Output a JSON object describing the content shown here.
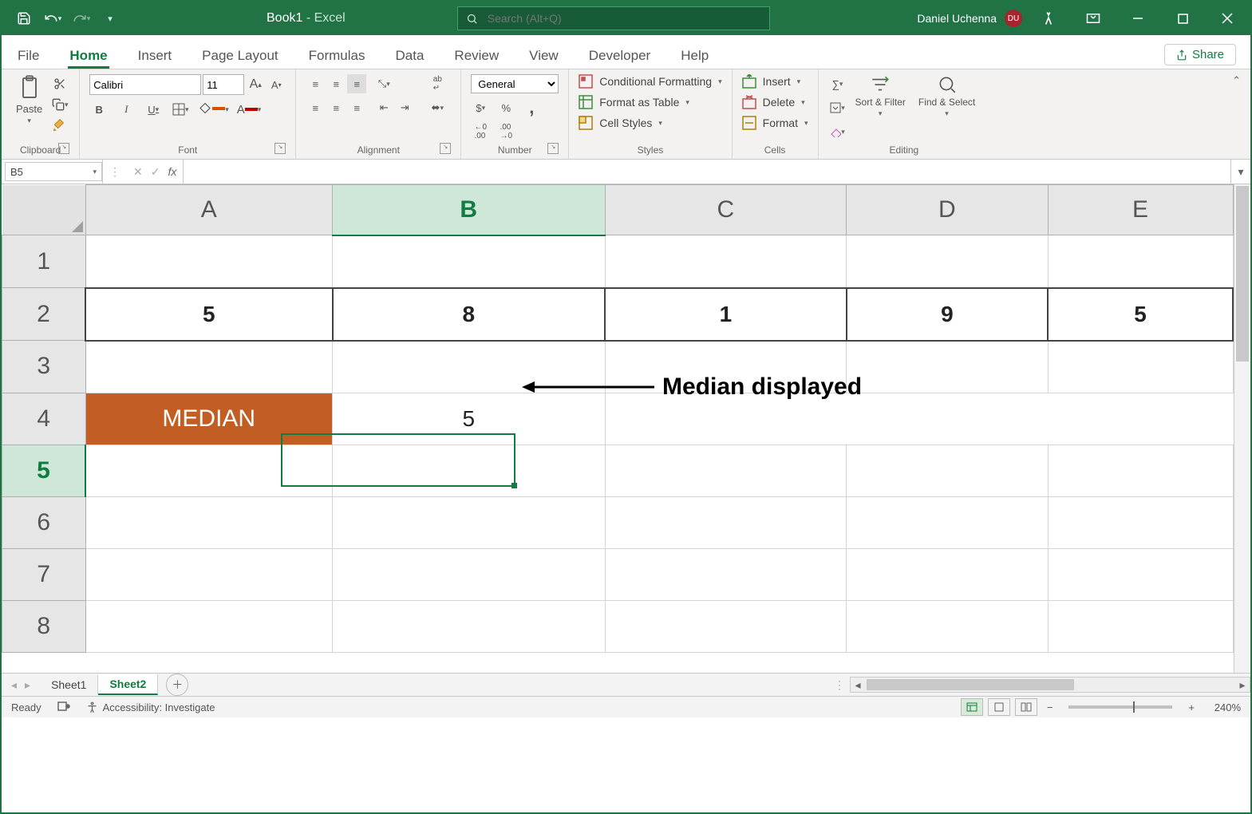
{
  "titlebar": {
    "doc": "Book1",
    "app": "Excel",
    "search_placeholder": "Search (Alt+Q)",
    "user": "Daniel Uchenna",
    "initials": "DU"
  },
  "menu": {
    "tabs": [
      "File",
      "Home",
      "Insert",
      "Page Layout",
      "Formulas",
      "Data",
      "Review",
      "View",
      "Developer",
      "Help"
    ],
    "active": "Home",
    "share": "Share"
  },
  "ribbon": {
    "clipboard": {
      "paste": "Paste",
      "label": "Clipboard"
    },
    "font": {
      "name": "Calibri",
      "size": "11",
      "label": "Font"
    },
    "alignment": {
      "label": "Alignment"
    },
    "number": {
      "format": "General",
      "label": "Number"
    },
    "styles": {
      "cond": "Conditional Formatting",
      "table": "Format as Table",
      "cell": "Cell Styles",
      "label": "Styles"
    },
    "cells": {
      "insert": "Insert",
      "delete": "Delete",
      "format": "Format",
      "label": "Cells"
    },
    "editing": {
      "sort": "Sort & Filter",
      "find": "Find & Select",
      "label": "Editing"
    }
  },
  "formulaBar": {
    "nameBox": "B5",
    "formula": ""
  },
  "grid": {
    "cols": [
      "A",
      "B",
      "C",
      "D",
      "E"
    ],
    "rows": [
      "1",
      "2",
      "3",
      "4",
      "5",
      "6",
      "7",
      "8"
    ],
    "selectedCol": "B",
    "selectedRow": "5",
    "cells": {
      "A2": "5",
      "B2": "8",
      "C2": "1",
      "D2": "9",
      "E2": "5",
      "A4": "MEDIAN",
      "B4": "5"
    },
    "annotation": "Median displayed"
  },
  "sheets": {
    "tabs": [
      "Sheet1",
      "Sheet2"
    ],
    "active": "Sheet2"
  },
  "status": {
    "ready": "Ready",
    "access": "Accessibility: Investigate",
    "zoom": "240%"
  }
}
